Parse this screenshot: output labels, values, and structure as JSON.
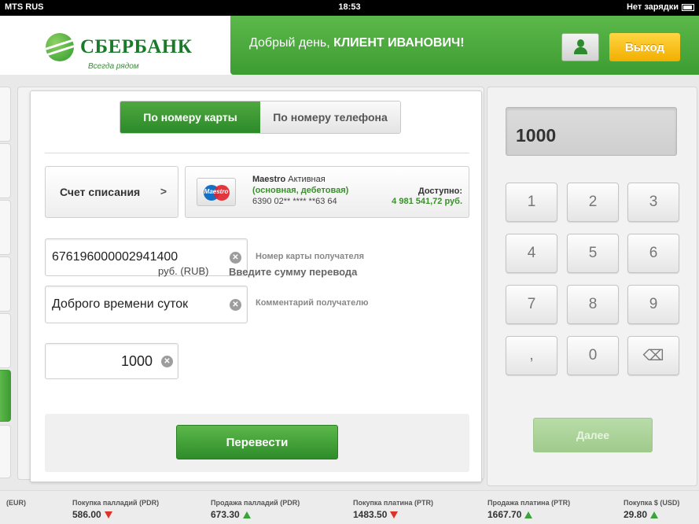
{
  "status_bar": {
    "carrier": "MTS RUS",
    "time": "18:53",
    "battery_text": "Нет зарядки"
  },
  "header": {
    "logo_title": "СБЕРБАНК",
    "logo_subtitle": "Всегда рядом",
    "greeting_prefix": "Добрый день,",
    "greeting_name": "КЛИЕНТ ИВАНОВИЧ!",
    "user_icon": "user-icon",
    "exit_label": "Выход"
  },
  "tabs": [
    {
      "label": "По номеру карты",
      "active": true
    },
    {
      "label": "По номеру телефона",
      "active": false
    }
  ],
  "account": {
    "label": "Счет списания",
    "chevron": ">"
  },
  "card": {
    "brand_label": "Maestro",
    "name": "Maestro",
    "status": "Активная",
    "type": "(основная, дебетовая)",
    "number": "6390 02** **** **63 64",
    "available_label": "Доступно:",
    "available_value": "4 981 541,72 руб."
  },
  "recipient_card": {
    "value": "676196000002941400",
    "hint": "Номер карты получателя"
  },
  "comment": {
    "value": "Доброго времени суток",
    "hint": "Комментарий получателю"
  },
  "amount": {
    "value": "1000",
    "currency": "руб. (RUB)",
    "hint": "Введите сумму перевода"
  },
  "transfer_label": "Перевести",
  "keypad": {
    "display": "1000",
    "keys": [
      "1",
      "2",
      "3",
      "4",
      "5",
      "6",
      "7",
      "8",
      "9",
      ",",
      "0",
      "⌫"
    ],
    "next_label": "Далее"
  },
  "ticker": [
    {
      "label": "(EUR)",
      "value": "",
      "trend": ""
    },
    {
      "label": "Покупка палладий (PDR)",
      "value": "586.00",
      "trend": "down"
    },
    {
      "label": "Продажа палладий (PDR)",
      "value": "673.30",
      "trend": "up"
    },
    {
      "label": "Покупка платина (PTR)",
      "value": "1483.50",
      "trend": "down"
    },
    {
      "label": "Продажа платина (PTR)",
      "value": "1667.70",
      "trend": "up"
    },
    {
      "label": "Покупка $ (USD)",
      "value": "29.80",
      "trend": "up"
    }
  ],
  "colors": {
    "brand_green": "#3d9c32",
    "accent_yellow": "#f2ae00",
    "up": "#3aa33a",
    "down": "#e0302a"
  }
}
